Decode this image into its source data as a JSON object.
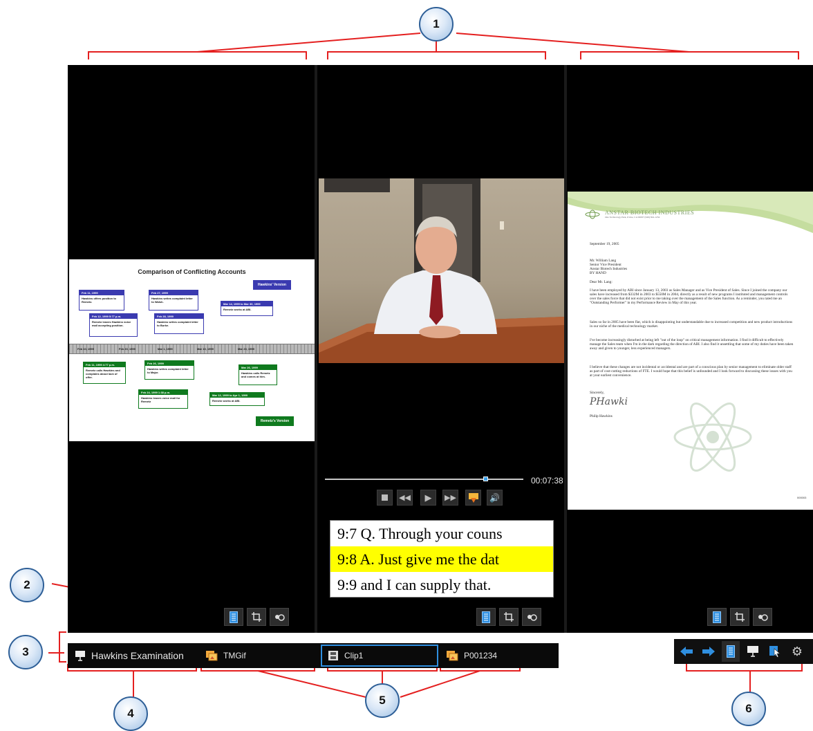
{
  "callouts": [
    "1",
    "2",
    "3",
    "4",
    "5",
    "6"
  ],
  "left_pane": {
    "chart_title": "Comparison of Conflicting Accounts",
    "legend_top": "Hawkins' Version",
    "legend_bottom": "Remetz's Version",
    "ruler_labels": [
      "Feb 10, 1999",
      "Feb 20, 1999",
      "Mar 1, 1999",
      "Mar 10, 1999",
      "Mar 20, 1999"
    ],
    "blue_events": [
      {
        "date": "Feb 11, 1999",
        "text": "Hawkins offers position to Remetz."
      },
      {
        "date": "Feb 12, 1999 5:77 p.m.",
        "text": "Remetz leaves Hawkins voice mail accepting position."
      },
      {
        "date": "Feb 27, 1999",
        "text": "Hawkins writes complaint letter to Walsh."
      },
      {
        "date": "Feb 28, 1999",
        "text": "Hawkins writes complaint letter to Burke."
      },
      {
        "date": "Mar 14, 1999 to Mar 30, 1999",
        "text": "Remetz works at ABI."
      }
    ],
    "green_events": [
      {
        "date": "Feb 11, 1999 4:77 p.m.",
        "text": "Remetz calls Hawkins and complains about lack of offer."
      },
      {
        "date": "Feb 26, 1999",
        "text": "Hawkins writes complaint letter to Major."
      },
      {
        "date": "Feb 24, 1999 1:38 p.m.",
        "text": "Hawkins leaves voice mail for Remetz"
      },
      {
        "date": "Mar 12, 1999 to Apr 1, 1999",
        "text": "Remetz works at ABI."
      },
      {
        "date": "Mar 26, 1999",
        "text": "Hawkins calls Remetz and comes at him."
      }
    ]
  },
  "middle_pane": {
    "timecode": "00:07:38",
    "seek_progress": 0.81,
    "controls": [
      "stop",
      "rewind",
      "play",
      "fast-forward",
      "clip",
      "volume"
    ],
    "transcript": [
      {
        "text": "9:7 Q.   Through your couns",
        "highlight": false
      },
      {
        "text": "9:8 A.   Just give me the dat",
        "highlight": true
      },
      {
        "text": "9:9 and I can supply that.",
        "highlight": false
      }
    ]
  },
  "right_pane": {
    "company": "ANSTAR BIOTECH INDUSTRIES",
    "company_address": "One Technology Park, Irvine, CA 92697 (949) 824-1234",
    "date": "September 19, 2005",
    "address": [
      "Mr. William Lang",
      "Senior Vice President",
      "Anstar Biotech Industries",
      "BY HAND"
    ],
    "salutation": "Dear Mr. Lang:",
    "paragraphs": [
      "I have been employed by ABI since January 13, 2003 as Sales Manager and as Vice President of Sales. Since I joined the company our sales have increased from $332M in 2003 to $550M in 2004, directly as a result of new programs I instituted and management controls over the sales force that did not exist prior to me taking over the management of the Sales function. As a reminder, you rated me an \"Outstanding Performer\" in my Performance Review in May of this year.",
      "Sales so far in 2005 have been flat, which is disappointing but understandable due to increased competition and new product introductions in our niche of the medical technology market.",
      "I've become increasingly disturbed at being left \"out of the loop\" on critical management information. I find it difficult to effectively manage the Sales team when I'm in the dark regarding the direction of ABI. I also find it unsettling that some of my duties have been taken away and given to younger, less experienced managers.",
      "I believe that these changes are not incidental or accidental and are part of a conscious plan by senior management to eliminate older staff as part of cost-cutting reductions of FTE. I would hope that this belief is unfounded and I look forward to discussing these issues with you at your earliest convenience."
    ],
    "closing": "Sincerely,",
    "signature": "PHawki",
    "signer": "Philip Hawkins",
    "bates": "000003"
  },
  "pane_toolbar": [
    "pane-document-icon",
    "crop-icon",
    "zoom-icon"
  ],
  "bottom_bar": {
    "presentation": "Hawkins Examination",
    "tabs": [
      {
        "label": "TMGif",
        "icon": "image-doc-icon",
        "selected": false
      },
      {
        "label": "Clip1",
        "icon": "film-icon",
        "selected": true
      },
      {
        "label": "P001234",
        "icon": "image-doc-icon",
        "selected": false
      }
    ]
  },
  "right_tools": [
    "back-arrow-icon",
    "forward-arrow-icon",
    "document-icon",
    "presentation-icon",
    "pointer-icon",
    "settings-gear-icon"
  ]
}
